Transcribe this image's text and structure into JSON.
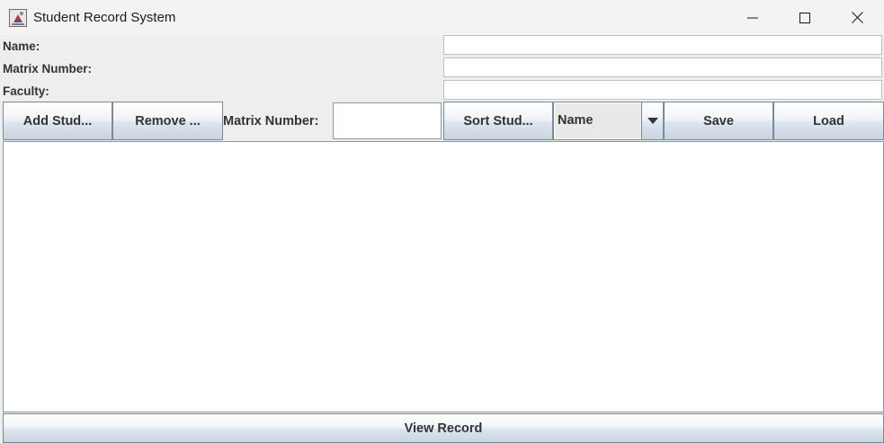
{
  "window": {
    "title": "Student Record System"
  },
  "form": {
    "name_label": "Name:",
    "name_value": "",
    "matrix_label": "Matrix Number:",
    "matrix_value": "",
    "faculty_label": "Faculty:",
    "faculty_value": ""
  },
  "toolbar": {
    "add_label": "Add Stud...",
    "remove_label": "Remove ...",
    "matrix_label": "Matrix Number:",
    "matrix_value": "",
    "sort_label": "Sort Stud...",
    "sort_selected": "Name",
    "save_label": "Save",
    "load_label": "Load"
  },
  "records": {
    "text": ""
  },
  "footer": {
    "view_label": "View Record"
  },
  "icons": {
    "app": "java-cup-icon",
    "minimize": "minimize-icon",
    "maximize": "maximize-icon",
    "close": "close-icon",
    "dropdown": "triangle-down-icon"
  }
}
